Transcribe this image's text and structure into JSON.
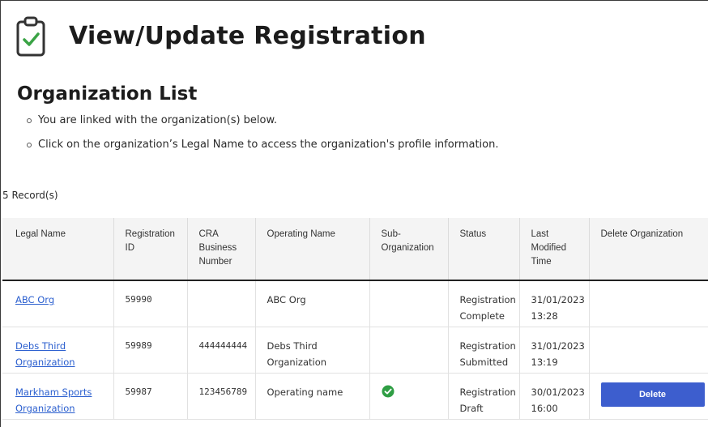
{
  "page": {
    "title": "View/Update Registration",
    "section_title": "Organization List",
    "info_items": [
      "You are linked with the organization(s) below.",
      "Click on the organization’s Legal Name to access the organization's profile information."
    ],
    "record_count": "5 Record(s)"
  },
  "table": {
    "headers": [
      "Legal Name",
      "Registration ID",
      "CRA Business Number",
      "Operating Name",
      "Sub-Organization",
      "Status",
      "Last Modified Time",
      "Delete Organization"
    ],
    "rows": [
      {
        "legal_name": "ABC Org",
        "registration_id": "59990",
        "cra_number": "",
        "operating_name": "ABC Org",
        "sub_org": false,
        "status": "Registration Complete",
        "modified": "31/01/2023 13:28",
        "delete_label": ""
      },
      {
        "legal_name": "Debs Third Organization",
        "registration_id": "59989",
        "cra_number": "444444444",
        "operating_name": "Debs Third Organization",
        "sub_org": false,
        "status": "Registration Submitted",
        "modified": "31/01/2023 13:19",
        "delete_label": ""
      },
      {
        "legal_name": "Markham Sports Organization",
        "registration_id": "59987",
        "cra_number": "123456789",
        "operating_name": "Operating name",
        "sub_org": true,
        "status": "Registration Draft",
        "modified": "30/01/2023 16:00",
        "delete_label": "Delete"
      }
    ]
  },
  "colors": {
    "link": "#2b5fcf",
    "delete_button": "#3d5ece",
    "check_icon": "#2f9e44"
  },
  "icons": {
    "title_icon": "clipboard-check-icon",
    "sub_org_icon": "check-circle-icon"
  }
}
